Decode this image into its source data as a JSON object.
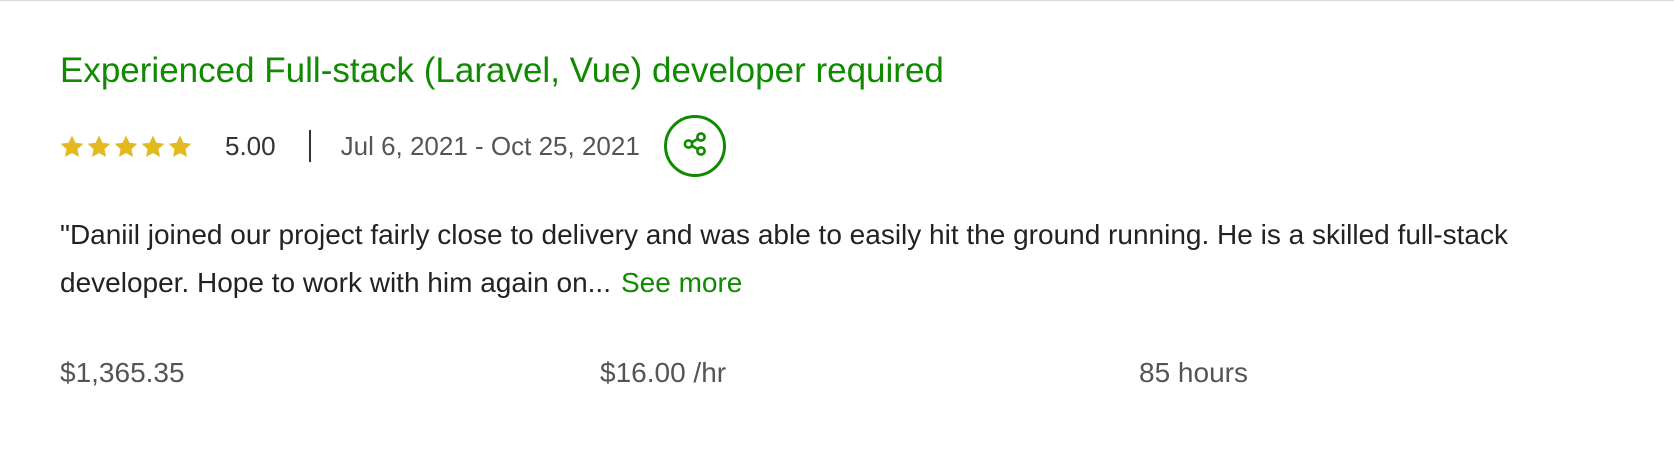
{
  "job": {
    "title": "Experienced Full-stack (Laravel, Vue) developer required",
    "rating": 5,
    "rating_display": "5.00",
    "date_range": "Jul 6, 2021 - Oct 25, 2021",
    "share_icon": "share-icon",
    "feedback": "\"Daniil joined our project fairly close to delivery and was able to easily hit the ground running. He is a skilled full-stack developer. Hope to work with him again on...",
    "see_more_label": "See more",
    "earned": "$1,365.35",
    "rate": "$16.00 /hr",
    "hours": "85 hours"
  },
  "colors": {
    "accent": "#108a00",
    "star": "#e3b920",
    "text": "#222222",
    "muted": "#555555"
  }
}
